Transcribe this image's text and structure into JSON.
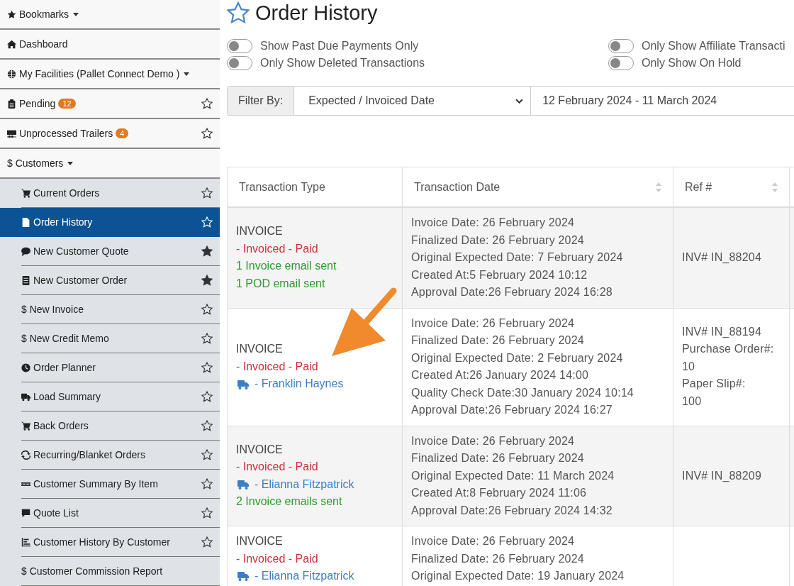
{
  "sidebar": {
    "items": [
      {
        "kind": "star",
        "label": "Bookmarks",
        "caret": true
      },
      {
        "kind": "home",
        "label": "Dashboard"
      },
      {
        "kind": "globe",
        "label": "My Facilities (Pallet Connect Demo )",
        "caret": true
      },
      {
        "kind": "clipboard",
        "label": "Pending",
        "badge": "12",
        "starred": false
      },
      {
        "kind": "trailer",
        "label": "Unprocessed Trailers",
        "badge": "4",
        "starred": false
      },
      {
        "kind": "plain",
        "label": "$ Customers",
        "caret": true,
        "children": [
          {
            "kind": "cart",
            "label": "Current Orders",
            "starred": false,
            "selected": false
          },
          {
            "kind": "file",
            "label": "Order History",
            "starred": false,
            "selected": true
          },
          {
            "kind": "comment",
            "label": "New Customer Quote",
            "starred": true,
            "selected": false
          },
          {
            "kind": "list",
            "label": "New Customer Order",
            "starred": true,
            "selected": false
          },
          {
            "kind": "plain",
            "label": "$ New Invoice",
            "starred": false,
            "selected": false
          },
          {
            "kind": "plain",
            "label": "$ New Credit Memo",
            "starred": false,
            "selected": false
          },
          {
            "kind": "clock",
            "label": "Order Planner",
            "starred": false,
            "selected": false
          },
          {
            "kind": "truck",
            "label": "Load Summary",
            "starred": false,
            "selected": false
          },
          {
            "kind": "cart",
            "label": "Back Orders",
            "starred": false,
            "selected": false
          },
          {
            "kind": "repeat",
            "label": "Recurring/Blanket Orders",
            "starred": false,
            "selected": false
          },
          {
            "kind": "pallet",
            "label": "Customer Summary By Item",
            "starred": false,
            "selected": false
          },
          {
            "kind": "quote",
            "label": "Quote List",
            "starred": false,
            "selected": false
          },
          {
            "kind": "chart",
            "label": "Customer History By Customer",
            "starred": false,
            "selected": false
          },
          {
            "kind": "plain",
            "label": "$ Customer Commission Report",
            "selected": false
          }
        ]
      }
    ]
  },
  "page": {
    "title": "Order History",
    "starred": false
  },
  "toggles": [
    {
      "label": "Show Past Due Payments Only",
      "on": false
    },
    {
      "label": "Only Show Deleted Transactions",
      "on": false
    },
    {
      "label": "Only Show Affiliate Transacti",
      "on": false
    },
    {
      "label": "Only Show On Hold",
      "on": false
    }
  ],
  "filter": {
    "label": "Filter By:",
    "select": "Expected / Invoiced Date",
    "date_range": "12 February 2024 - 11 March 2024"
  },
  "table": {
    "columns": [
      {
        "label": "Transaction Type",
        "sortable": false
      },
      {
        "label": "Transaction Date",
        "sortable": true
      },
      {
        "label": "Ref #",
        "sortable": true
      }
    ],
    "rows": [
      {
        "type": [
          {
            "kind": "plain",
            "text": "INVOICE"
          },
          {
            "kind": "status",
            "text": "- Invoiced - Paid"
          },
          {
            "kind": "email",
            "text": "1 Invoice email sent"
          },
          {
            "kind": "email",
            "text": "1 POD email sent"
          }
        ],
        "dates": [
          "Invoice Date: 26 February 2024",
          "Finalized Date: 26 February 2024",
          "Original Expected Date: 7 February 2024",
          "Created At:5 February 2024 10:12",
          "Approval Date:26 February 2024 16:28"
        ],
        "ref": [
          "INV# IN_88204"
        ]
      },
      {
        "type": [
          {
            "kind": "plain",
            "text": "INVOICE"
          },
          {
            "kind": "status",
            "text": "- Invoiced - Paid"
          },
          {
            "kind": "driver",
            "text": "- Franklin Haynes"
          }
        ],
        "dates": [
          "Invoice Date: 26 February 2024",
          "Finalized Date: 26 February 2024",
          "Original Expected Date: 2 February 2024",
          "Created At:26 January 2024 14:00",
          "Quality Check Date:30 January 2024 10:14",
          "Approval Date:26 February 2024 16:27"
        ],
        "ref": [
          "INV# IN_88194",
          "Purchase Order#:",
          "10",
          "Paper Slip#:",
          "100"
        ]
      },
      {
        "type": [
          {
            "kind": "plain",
            "text": "INVOICE"
          },
          {
            "kind": "status",
            "text": "- Invoiced - Paid"
          },
          {
            "kind": "driver",
            "text": "- Elianna Fitzpatrick"
          },
          {
            "kind": "email",
            "text": "2 Invoice emails sent"
          }
        ],
        "dates": [
          "Invoice Date: 26 February 2024",
          "Finalized Date: 26 February 2024",
          "Original Expected Date: 11 March 2024",
          "Created At:8 February 2024 11:06",
          "Approval Date:26 February 2024 14:32"
        ],
        "ref": [
          "INV# IN_88209"
        ]
      },
      {
        "type": [
          {
            "kind": "plain",
            "text": "INVOICE"
          },
          {
            "kind": "status",
            "text": "- Invoiced - Paid"
          },
          {
            "kind": "driver",
            "text": "- Elianna Fitzpatrick"
          }
        ],
        "dates": [
          "Invoice Date: 26 February 2024",
          "Finalized Date: 26 February 2024",
          "Original Expected Date: 19 January 2024"
        ],
        "ref": []
      }
    ]
  },
  "annotation": {
    "kind": "arrow"
  }
}
